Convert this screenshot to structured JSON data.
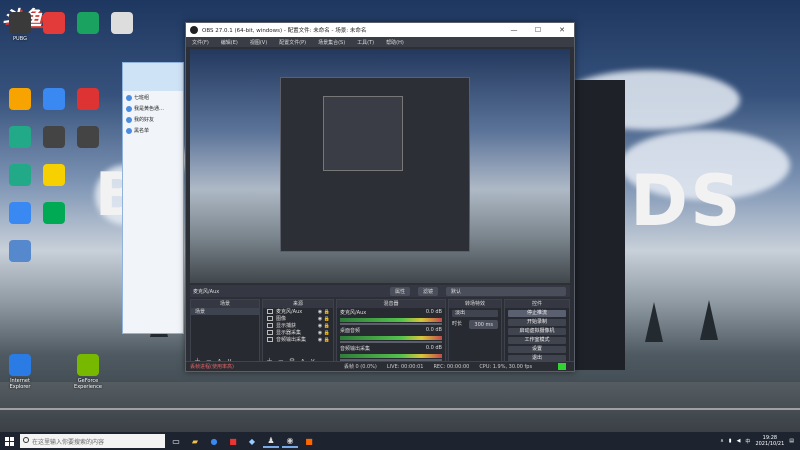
{
  "desktop": {
    "watermark": "斗鱼",
    "background_text_1": "DS",
    "icons": [
      {
        "label": "PUBG",
        "color": "#3a3a3a"
      },
      {
        "label": "",
        "color": "#e33a3a"
      },
      {
        "label": "",
        "color": "#1aa260"
      },
      {
        "label": "",
        "color": "#dddddd"
      },
      {
        "label": "",
        "color": "#f7a400"
      },
      {
        "label": "",
        "color": "#3a88f2"
      },
      {
        "label": "",
        "color": "#d33"
      },
      {
        "label": "",
        "color": "#2a8"
      },
      {
        "label": "",
        "color": "#444"
      },
      {
        "label": "",
        "color": "#444"
      },
      {
        "label": "",
        "color": "#2a8"
      },
      {
        "label": "",
        "color": "#f7d000"
      },
      {
        "label": "",
        "color": "#3a88f2"
      },
      {
        "label": "",
        "color": "#0a5"
      },
      {
        "label": "",
        "color": "#58c"
      },
      {
        "label": "Internet Explorer",
        "color": "#2a7be4"
      },
      {
        "label": "GeForce Experience",
        "color": "#76b900"
      }
    ]
  },
  "qq_window": {
    "items": [
      "七班组",
      "我是黄色通…",
      "我的好友",
      "黑名单"
    ]
  },
  "obs": {
    "title": "OBS 27.0.1 (64-bit, windows) - 配置文件: 未命名 - 场景: 未命名",
    "menu": [
      "文件(F)",
      "编辑(E)",
      "视图(V)",
      "配置文件(P)",
      "场景集合(S)",
      "工具(T)",
      "帮助(H)"
    ],
    "window_buttons": {
      "min": "—",
      "max": "☐",
      "close": "✕"
    },
    "source_bar": {
      "source": "麦克风/Aux",
      "props": "属性",
      "filters": "滤镜",
      "default": "默认"
    },
    "docks": {
      "scenes": {
        "title": "场景",
        "items": [
          "场景"
        ]
      },
      "sources": {
        "title": "来源",
        "items": [
          "麦克风/Aux",
          "图像",
          "显示捕获",
          "显示器采集",
          "音频输出采集"
        ]
      },
      "mixer": {
        "title": "混音器",
        "channels": [
          {
            "name": "麦克风/Aux",
            "db": "0.0 dB"
          },
          {
            "name": "桌面音频",
            "db": "0.0 dB"
          },
          {
            "name": "音频输出采集",
            "db": "0.0 dB"
          }
        ]
      },
      "transitions": {
        "title": "转场特效",
        "type": "淡出",
        "duration_label": "时长",
        "duration": "300 ms"
      },
      "controls": {
        "title": "控件",
        "buttons": [
          "停止推流",
          "开始录制",
          "启动虚拟摄像机",
          "工作室模式",
          "设置",
          "退出"
        ]
      }
    },
    "statusbar": {
      "warning": "丢帧进程(使用率高)",
      "dropped": "丢帧 0 (0.0%)",
      "live": "LIVE: 00:00:01",
      "rec": "REC: 00:00:00",
      "cpu": "CPU: 1.9%, 30.00 fps"
    }
  },
  "taskbar": {
    "search_placeholder": "在这里输入你要搜索的内容",
    "time": "19:28",
    "date": "2021/10/21"
  }
}
